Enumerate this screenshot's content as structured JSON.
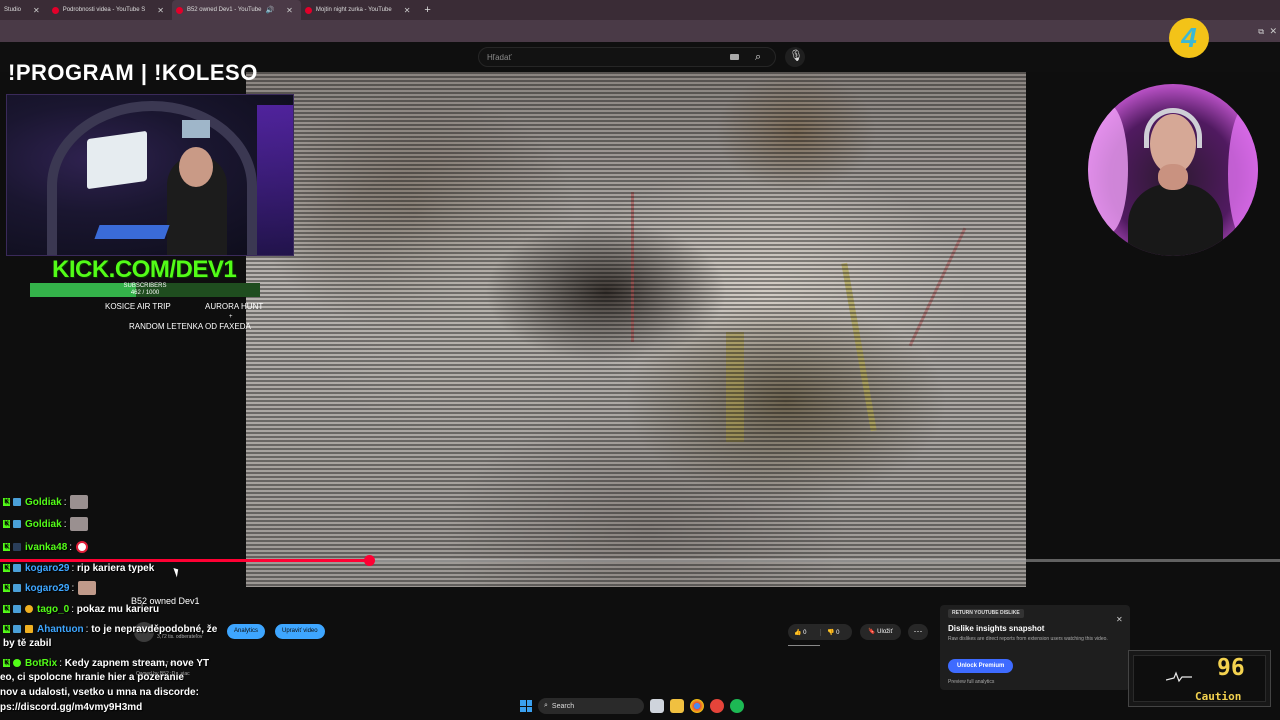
{
  "browser": {
    "tabs": [
      {
        "title": "Studio",
        "active": false
      },
      {
        "title": "Podrobnosti videa - YouTube S",
        "active": false
      },
      {
        "title": "B52 owned Dev1 - YouTube",
        "active": true
      },
      {
        "title": "Mojtin night zurka - YouTube",
        "active": false
      }
    ]
  },
  "youtube": {
    "search_placeholder": "Hľadať",
    "video_title": "B52 owned Dev1",
    "channel_subs": "3,72 tis. odberateľov",
    "analytics_label": "Analytics",
    "edit_label": "Upraviť video",
    "likes": "0",
    "dislikes": "0",
    "save_label": "Uložiť",
    "desc_line1": "17 rokmi",
    "desc_line2": "Owned by B52 :D ...viac",
    "progress_fraction": 0.289
  },
  "dislike_panel": {
    "badge": "RETURN YOUTUBE DISLIKE",
    "title": "Dislike insights snapshot",
    "desc": "Raw dislikes are direct reports from extension users watching this video.",
    "unlock_label": "Unlock Premium",
    "preview_label": "Preview full analytics"
  },
  "overlay": {
    "program": "!PROGRAM | !KOLESO",
    "kick": "KICK.COM/DEV1",
    "sub_label": "SUBSCRIBERS",
    "sub_count": "462 / 1000",
    "sub_fraction": 0.462,
    "goal1": "KOSICE AIR TRIP",
    "goal2": "AURORA HUNT",
    "goal_plus": "+",
    "goal3": "RANDOM LETENKA OD FAXEDA",
    "logo_text": "4"
  },
  "chat": [
    {
      "user": "Goldiak",
      "color": "#53fc18",
      "text": "",
      "emote": "cat"
    },
    {
      "user": "Goldiak",
      "color": "#53fc18",
      "text": "",
      "emote": "cat"
    },
    {
      "user": "ivanka48",
      "color": "#53fc18",
      "text": "",
      "emote": "round"
    },
    {
      "user": "kogaro29",
      "color": "#3ea6ff",
      "text": "rip kariera typek",
      "emote": ""
    },
    {
      "user": "kogaro29",
      "color": "#3ea6ff",
      "text": "",
      "emote": "cat"
    },
    {
      "user": "tago_0",
      "color": "#53fc18",
      "text": "pokaz mu karieru",
      "emote": ""
    },
    {
      "user": "Ahantuon",
      "color": "#3ea6ff",
      "text": "to je nepravděpodobné, že",
      "emote": ""
    }
  ],
  "chat_wrap": "by tě zabil",
  "chat_bot": {
    "user": "BotRix",
    "text": "Kedy zapnem stream, nove YT"
  },
  "chat_bot_lines": [
    "eo, ci spolocne hranie hier a pozeranie",
    "nov a udalosti, vsetko u mna na discorde:",
    "ps://discord.gg/m4vmy9H3md"
  ],
  "speed_widget": {
    "value": "96",
    "label": "Caution"
  },
  "taskbar": {
    "search_label": "Search"
  }
}
